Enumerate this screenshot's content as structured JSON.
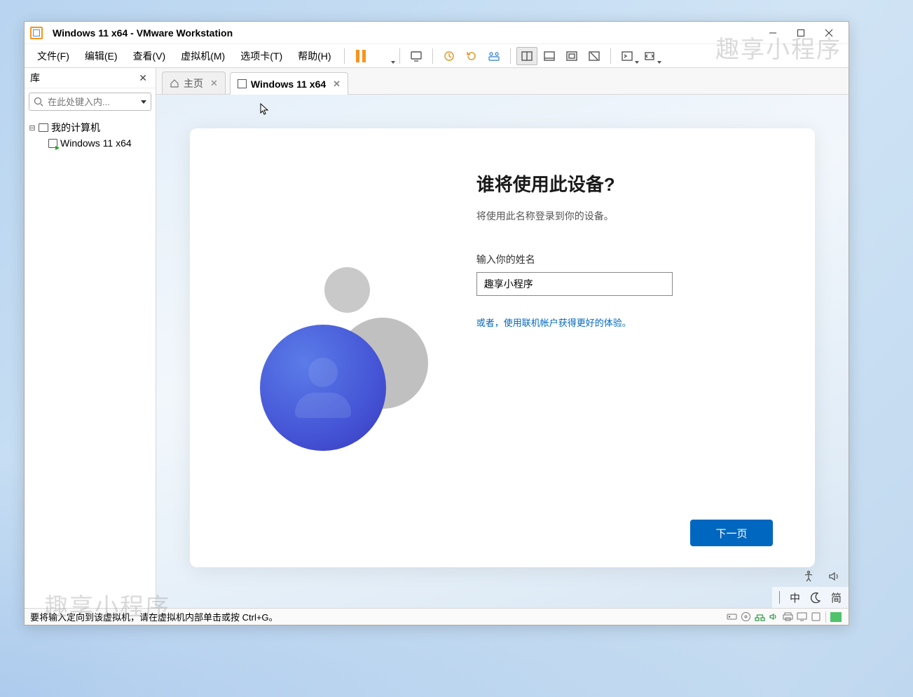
{
  "window": {
    "title": "Windows 11 x64 - VMware Workstation"
  },
  "menu": {
    "file": "文件(F)",
    "edit": "编辑(E)",
    "view": "查看(V)",
    "vm": "虚拟机(M)",
    "tabs": "选项卡(T)",
    "help": "帮助(H)"
  },
  "library": {
    "title": "库",
    "search_placeholder": "在此处键入内...",
    "root": "我的计算机",
    "child": "Windows 11 x64"
  },
  "tabs": {
    "home": "主页",
    "active": "Windows 11 x64"
  },
  "oobe": {
    "heading": "谁将使用此设备?",
    "subtitle": "将使用此名称登录到你的设备。",
    "name_label": "输入你的姓名",
    "name_value": "趣享小程序",
    "link": "或者，使用联机帐户获得更好的体验。",
    "next": "下一页"
  },
  "ime": {
    "lang": "中",
    "mode": "简"
  },
  "status": {
    "hint": "要将输入定向到该虚拟机，请在虚拟机内部单击或按 Ctrl+G。"
  },
  "watermark": "趣享小程序"
}
